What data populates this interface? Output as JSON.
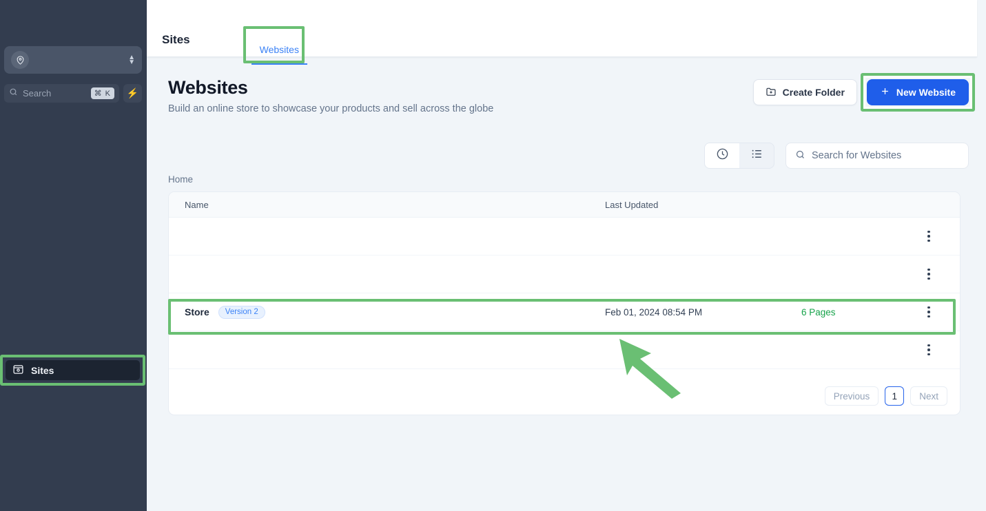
{
  "sidebar": {
    "workspace": {
      "icon": "user-location-icon",
      "value": ""
    },
    "search": {
      "placeholder": "Search",
      "shortcut": "⌘ K",
      "icon": "search-icon"
    },
    "quick_action": {
      "icon": "bolt-icon"
    },
    "items": [
      {
        "label": "Sites",
        "icon": "sites-icon",
        "active": true,
        "highlighted": true
      }
    ]
  },
  "topbar": {
    "tabs": [
      {
        "label": "Sites",
        "active": false
      },
      {
        "label": "Websites",
        "active": true,
        "highlighted": true
      }
    ]
  },
  "header": {
    "title": "Websites",
    "subtitle": "Build an online store to showcase your products and sell across the globe",
    "create_folder_label": "Create Folder",
    "create_folder_icon": "folder-plus-icon",
    "new_website_label": "New Website",
    "new_website_icon": "plus-icon",
    "new_website_color": "#1f5eea"
  },
  "toolbar": {
    "recent_view_icon": "clock-icon",
    "list_view_icon": "list-icon",
    "search_placeholder": "Search for Websites",
    "search_icon": "search-icon"
  },
  "breadcrumb": "Home",
  "table": {
    "columns": [
      "Name",
      "Last Updated"
    ],
    "rows": [
      {
        "name": "",
        "badge": "",
        "last_updated": "",
        "pages": "",
        "menu_icon": "kebab-menu-icon"
      },
      {
        "name": "",
        "badge": "",
        "last_updated": "",
        "pages": "",
        "menu_icon": "kebab-menu-icon"
      },
      {
        "name": "Store",
        "badge": "Version 2",
        "last_updated": "Feb 01, 2024 08:54 PM",
        "pages": "6 Pages",
        "menu_icon": "kebab-menu-icon",
        "highlighted": true
      },
      {
        "name": "",
        "badge": "",
        "last_updated": "",
        "pages": "",
        "menu_icon": "kebab-menu-icon"
      }
    ]
  },
  "pagination": {
    "previous_label": "Previous",
    "current_page": "1",
    "next_label": "Next"
  },
  "annotations": {
    "highlight_color": "#6abf73",
    "arrow": "pointer-arrow-up-left"
  }
}
